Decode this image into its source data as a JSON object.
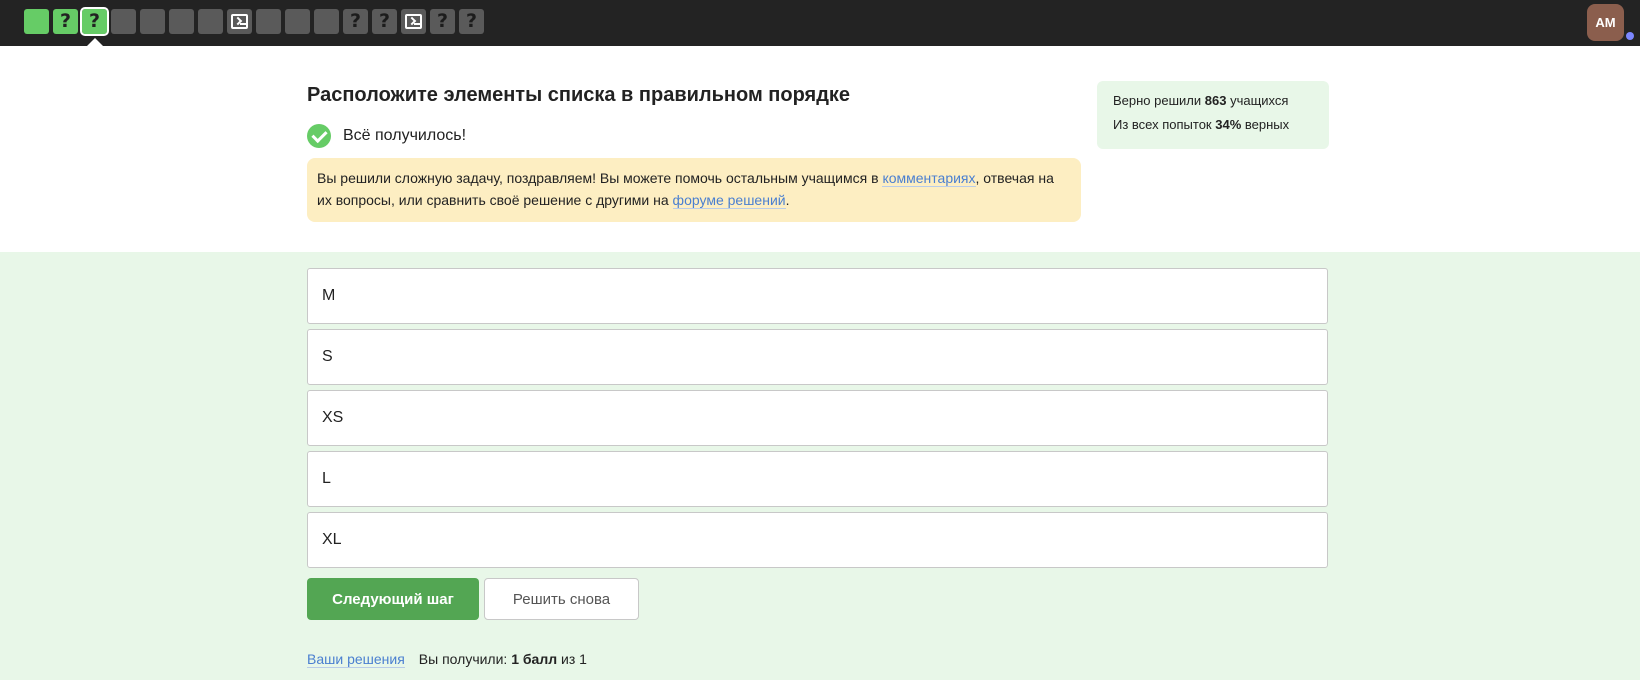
{
  "steps": [
    {
      "type": "done",
      "icon": "",
      "name": "step-done"
    },
    {
      "type": "done",
      "icon": "?",
      "name": "step-quiz"
    },
    {
      "type": "done current",
      "icon": "?",
      "name": "step-current"
    },
    {
      "type": "plain",
      "icon": "",
      "name": "step"
    },
    {
      "type": "plain",
      "icon": "",
      "name": "step"
    },
    {
      "type": "plain",
      "icon": "",
      "name": "step"
    },
    {
      "type": "plain",
      "icon": "",
      "name": "step"
    },
    {
      "type": "plain",
      "icon": "terminal",
      "name": "step-code"
    },
    {
      "type": "plain",
      "icon": "",
      "name": "step"
    },
    {
      "type": "plain",
      "icon": "",
      "name": "step"
    },
    {
      "type": "plain",
      "icon": "",
      "name": "step"
    },
    {
      "type": "plain",
      "icon": "?",
      "name": "step-quiz"
    },
    {
      "type": "plain",
      "icon": "?",
      "name": "step-quiz"
    },
    {
      "type": "plain",
      "icon": "terminal",
      "name": "step-code"
    },
    {
      "type": "plain",
      "icon": "?",
      "name": "step-quiz"
    },
    {
      "type": "plain",
      "icon": "?",
      "name": "step-quiz"
    }
  ],
  "user": {
    "initials": "AM"
  },
  "task": {
    "title": "Расположите элементы списка в правильном порядке",
    "success": "Всё получилось!",
    "notice_part1": "Вы решили сложную задачу, поздравляем! Вы можете помочь остальным учащимся в ",
    "notice_link1": "комментариях",
    "notice_part2": ", отвечая на их вопросы, или сравнить своё решение с другими на ",
    "notice_link2": "форуме решений",
    "notice_part3": "."
  },
  "stats": {
    "solved_prefix": "Верно решили ",
    "solved_count": "863",
    "solved_suffix": " учащихся",
    "attempts_prefix": "Из всех попыток ",
    "attempts_percent": "34%",
    "attempts_suffix": " верных"
  },
  "options": [
    "M",
    "S",
    "XS",
    "L",
    "XL"
  ],
  "buttons": {
    "next": "Следующий шаг",
    "retry": "Решить снова"
  },
  "footer": {
    "solutions_link": "Ваши решения",
    "score_prefix": "Вы получили: ",
    "score_value": "1 балл",
    "score_suffix": " из 1"
  }
}
